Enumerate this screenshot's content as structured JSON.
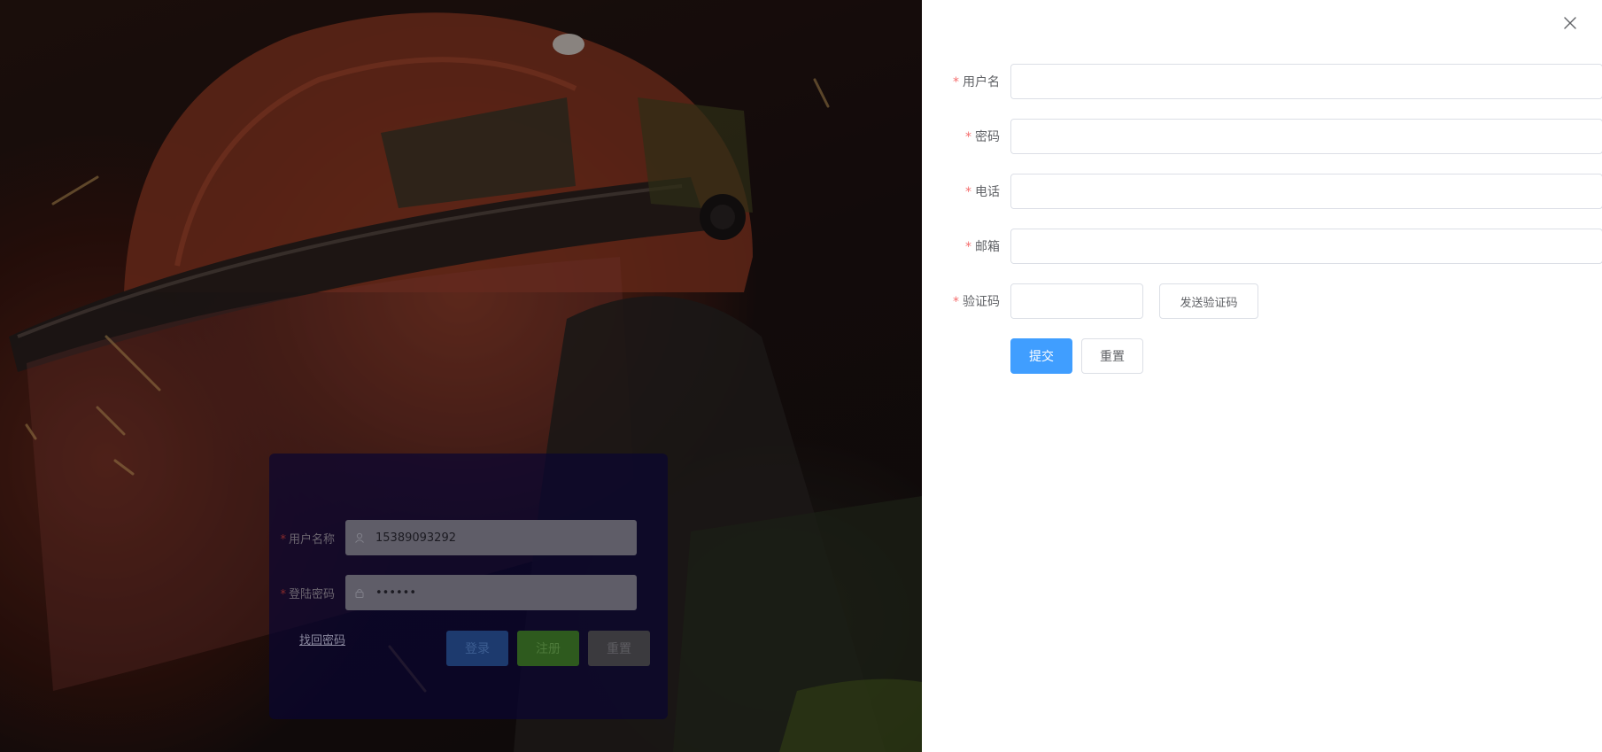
{
  "login": {
    "username_label": "用户名称",
    "username_value": "15389093292",
    "password_label": "登陆密码",
    "password_value": "••••••",
    "required_mark": "*",
    "forgot_link": "找回密码",
    "login_button": "登录",
    "register_button": "注册",
    "reset_button": "重置"
  },
  "register": {
    "required_mark": "*",
    "fields": {
      "username": {
        "label": "用户名",
        "value": ""
      },
      "password": {
        "label": "密码",
        "value": ""
      },
      "phone": {
        "label": "电话",
        "value": ""
      },
      "email": {
        "label": "邮箱",
        "value": ""
      },
      "captcha": {
        "label": "验证码",
        "value": ""
      }
    },
    "send_code_button": "发送验证码",
    "submit_button": "提交",
    "reset_button": "重置"
  },
  "icons": {
    "close": "close-icon",
    "user": "user-icon",
    "lock": "lock-icon"
  },
  "colors": {
    "primary": "#409eff",
    "required": "#f56c6c",
    "border": "#dcdfe6"
  }
}
